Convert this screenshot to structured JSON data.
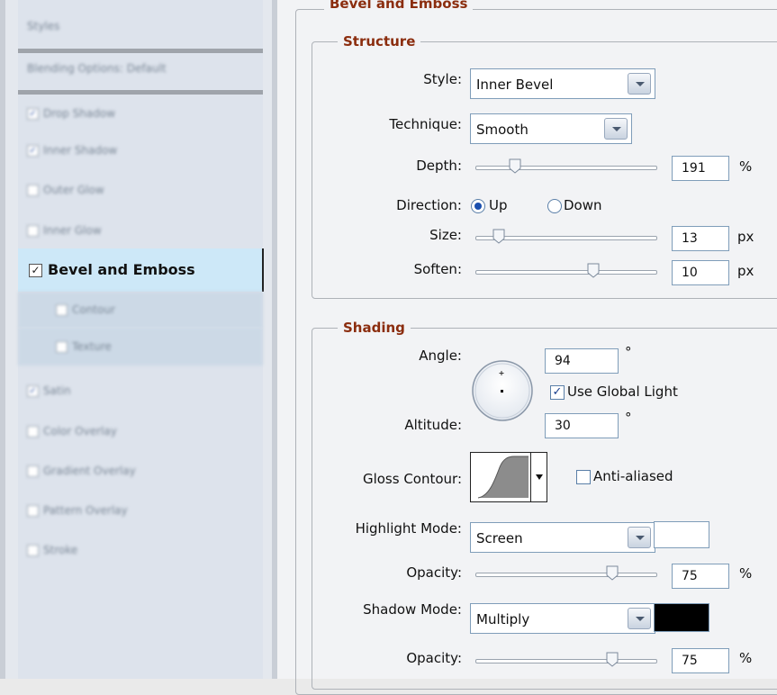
{
  "styles_list": {
    "styles_header": "Styles",
    "blending_options": "Blending Options: Default",
    "items": [
      {
        "label": "Drop Shadow",
        "checked": true
      },
      {
        "label": "Inner Shadow",
        "checked": true
      },
      {
        "label": "Outer Glow",
        "checked": false
      },
      {
        "label": "Inner Glow",
        "checked": false
      },
      {
        "label": "Bevel and Emboss",
        "checked": true,
        "active": true
      },
      {
        "label": "Contour",
        "checked": false,
        "sub": true
      },
      {
        "label": "Texture",
        "checked": false,
        "sub": true
      },
      {
        "label": "Satin",
        "checked": true
      },
      {
        "label": "Color Overlay",
        "checked": false
      },
      {
        "label": "Gradient Overlay",
        "checked": false
      },
      {
        "label": "Pattern Overlay",
        "checked": false
      },
      {
        "label": "Stroke",
        "checked": false
      }
    ]
  },
  "bevel": {
    "group_title": "Bevel and Emboss",
    "structure": {
      "title": "Structure",
      "style_label": "Style:",
      "style_value": "Inner Bevel",
      "technique_label": "Technique:",
      "technique_value": "Smooth",
      "depth_label": "Depth:",
      "depth_value": "191",
      "depth_unit": "%",
      "depth_slider_fraction": 0.22,
      "direction_label": "Direction:",
      "direction_up": "Up",
      "direction_down": "Down",
      "direction_selected": "Up",
      "size_label": "Size:",
      "size_value": "13",
      "size_unit": "px",
      "size_slider_fraction": 0.13,
      "soften_label": "Soften:",
      "soften_value": "10",
      "soften_unit": "px",
      "soften_slider_fraction": 0.65
    },
    "shading": {
      "title": "Shading",
      "angle_label": "Angle:",
      "angle_value": "94",
      "angle_unit": "°",
      "use_global_light_label": "Use Global Light",
      "use_global_light_checked": true,
      "altitude_label": "Altitude:",
      "altitude_value": "30",
      "altitude_unit": "°",
      "gloss_contour_label": "Gloss Contour:",
      "anti_aliased_label": "Anti-aliased",
      "anti_aliased_checked": false,
      "highlight_mode_label": "Highlight Mode:",
      "highlight_mode_value": "Screen",
      "highlight_color": "#ffffff",
      "highlight_opacity_label": "Opacity:",
      "highlight_opacity_value": "75",
      "highlight_opacity_unit": "%",
      "highlight_opacity_fraction": 0.75,
      "shadow_mode_label": "Shadow Mode:",
      "shadow_mode_value": "Multiply",
      "shadow_color": "#000000",
      "shadow_opacity_label": "Opacity:",
      "shadow_opacity_value": "75",
      "shadow_opacity_unit": "%",
      "shadow_opacity_fraction": 0.75
    }
  }
}
